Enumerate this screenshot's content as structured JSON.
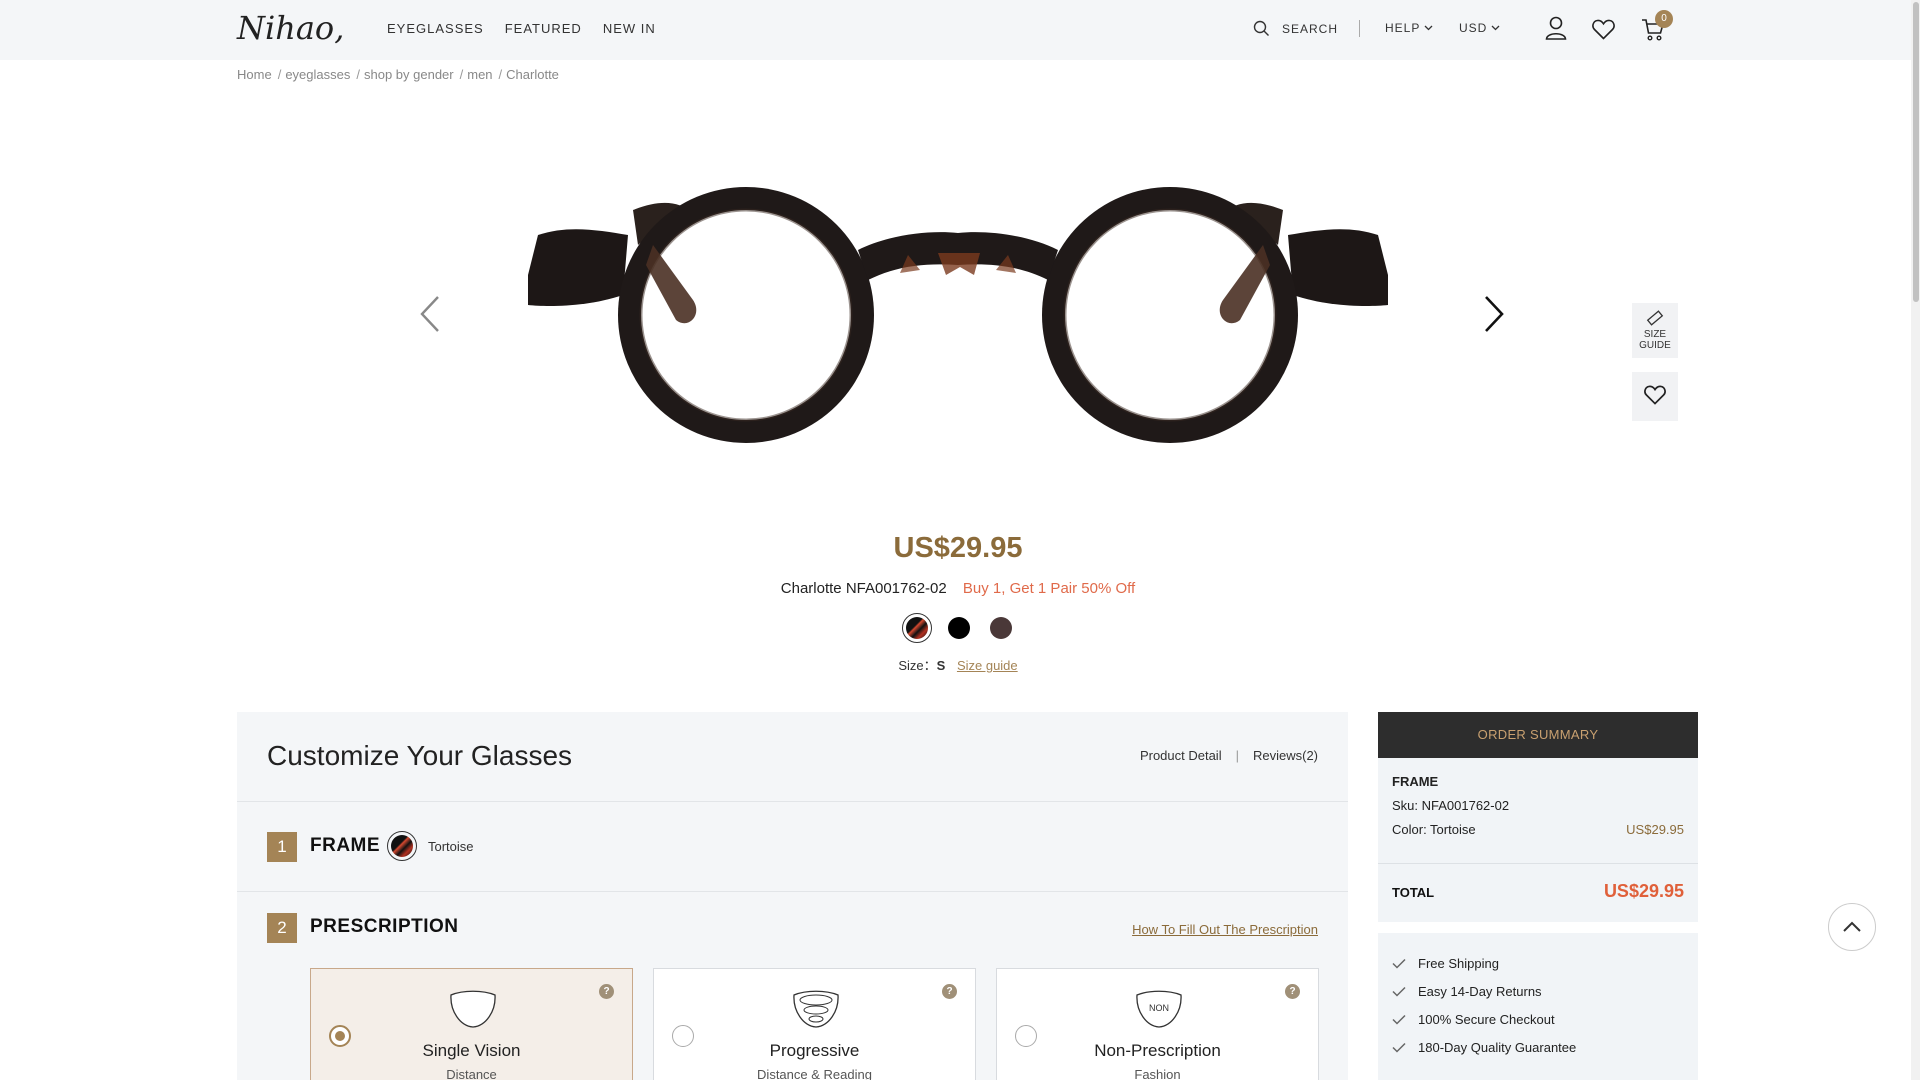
{
  "header": {
    "logo": "Nihao,",
    "nav": [
      "EYEGLASSES",
      "FEATURED",
      "NEW IN"
    ],
    "search_label": "SEARCH",
    "help_label": "HELP",
    "currency_label": "USD",
    "cart_count": "0"
  },
  "breadcrumb": [
    "Home",
    "eyeglasses",
    "shop by gender",
    "men",
    "Charlotte"
  ],
  "product": {
    "price": "US$29.95",
    "name_sku": "Charlotte NFA001762-02",
    "promo": "Buy 1, Get 1 Pair 50% Off",
    "size_label": "Size：",
    "size_value": "S",
    "size_guide_link": "Size guide",
    "swatches": [
      {
        "name": "Tortoise",
        "color": "#c0402e",
        "selected": true
      },
      {
        "name": "Black",
        "color": "#000000",
        "selected": false
      },
      {
        "name": "Brown",
        "color": "#4a3838",
        "selected": false
      }
    ]
  },
  "side_buttons": {
    "size_guide_line1": "SIZE",
    "size_guide_line2": "GUIDE"
  },
  "customize": {
    "title": "Customize Your Glasses",
    "product_detail": "Product Detail",
    "reviews": "Reviews(2)",
    "step1_num": "1",
    "step1_title": "FRAME",
    "frame_color": "Tortoise",
    "step2_num": "2",
    "step2_title": "PRESCRIPTION",
    "how_to_link": "How To Fill Out The Prescription",
    "lens_options": [
      {
        "name": "Single Vision",
        "sub": "Distance",
        "selected": true
      },
      {
        "name": "Progressive",
        "sub": "Distance & Reading",
        "selected": false
      },
      {
        "name": "Non-Prescription",
        "sub": "Fashion",
        "selected": false,
        "icon_text": "NON"
      }
    ]
  },
  "summary": {
    "header": "ORDER SUMMARY",
    "frame_label": "FRAME",
    "sku": "Sku: NFA001762-02",
    "color": "Color: Tortoise",
    "frame_price": "US$29.95",
    "total_label": "TOTAL",
    "total_value": "US$29.95"
  },
  "perks": [
    "Free Shipping",
    "Easy 14-Day Returns",
    "100% Secure Checkout",
    "180-Day Quality Guarantee"
  ],
  "colors": {
    "accent": "#a48456",
    "price": "#8b6b3a",
    "promo": "#e06a4a"
  }
}
